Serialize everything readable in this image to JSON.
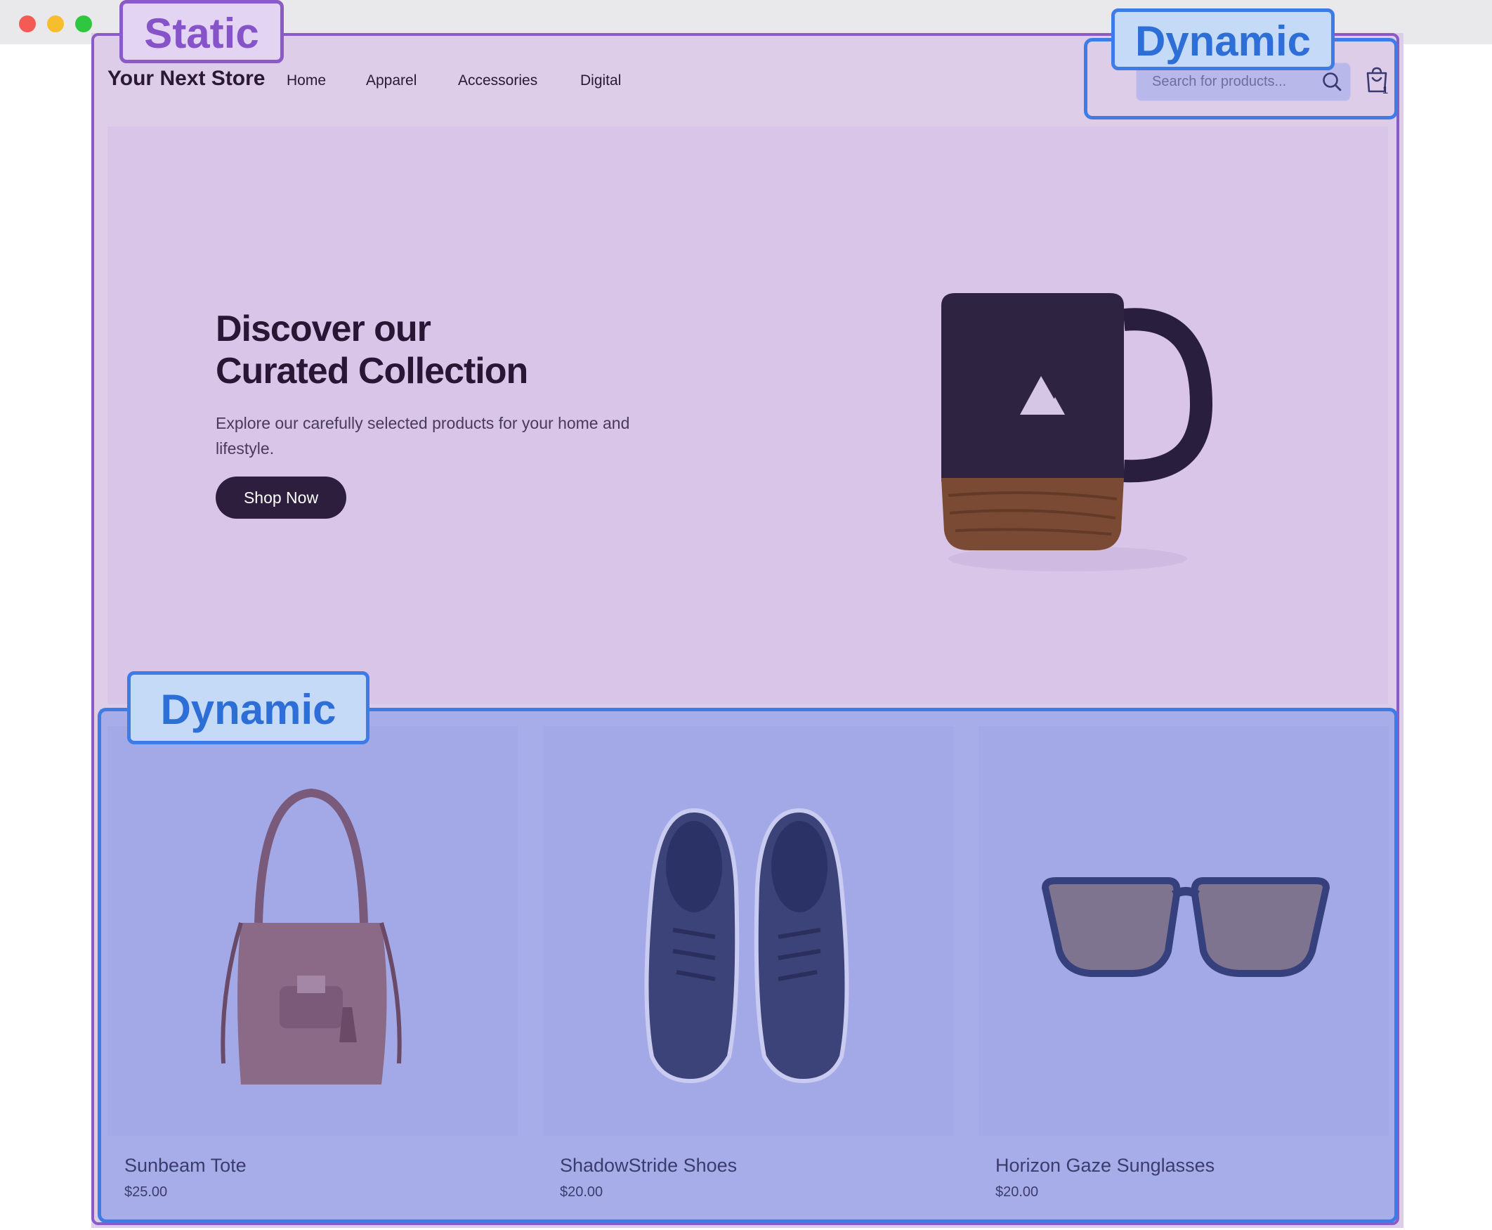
{
  "store": {
    "title": "Your Next Store"
  },
  "nav": {
    "items": [
      {
        "label": "Home"
      },
      {
        "label": "Apparel"
      },
      {
        "label": "Accessories"
      },
      {
        "label": "Digital"
      }
    ]
  },
  "search": {
    "placeholder": "Search for products..."
  },
  "cart": {
    "count": "1"
  },
  "hero": {
    "title_line1": "Discover our",
    "title_line2": "Curated Collection",
    "description": "Explore our carefully selected products for your home and lifestyle.",
    "cta_label": "Shop Now"
  },
  "products": [
    {
      "name": "Sunbeam Tote",
      "price": "$25.00"
    },
    {
      "name": "ShadowStride Shoes",
      "price": "$20.00"
    },
    {
      "name": "Horizon Gaze Sunglasses",
      "price": "$20.00"
    }
  ],
  "annotations": {
    "static_label": "Static",
    "dynamic_label_top": "Dynamic",
    "dynamic_label_bottom": "Dynamic"
  },
  "colors": {
    "static_outline": "#8a5ac6",
    "dynamic_outline": "#3d7ce6",
    "primary_button": "#2e1e3e"
  },
  "icons": {
    "window_close": "red-dot-icon",
    "window_minimize": "yellow-dot-icon",
    "window_maximize": "green-dot-icon",
    "search": "search-icon",
    "cart": "shopping-bag-icon"
  }
}
